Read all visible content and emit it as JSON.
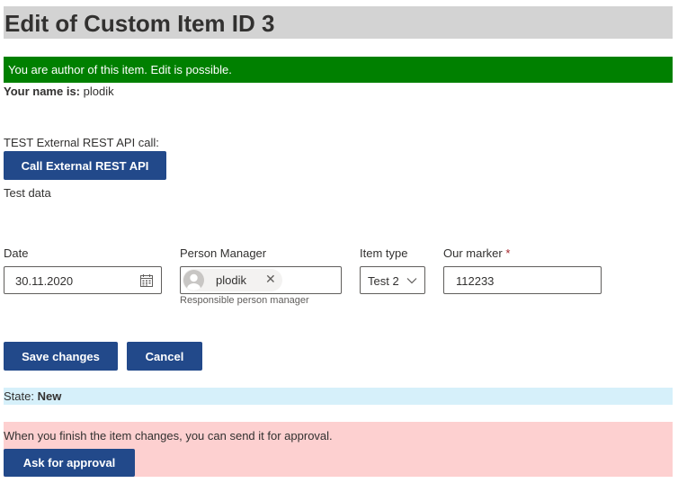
{
  "page": {
    "title": "Edit of Custom Item ID 3",
    "author_message": "You are author of this item. Edit is possible.",
    "your_name_label": "Your name is:",
    "your_name_value": "plodik"
  },
  "rest_api": {
    "label": "TEST External REST API call:",
    "button_label": "Call External REST API",
    "test_data": "Test data"
  },
  "form": {
    "date": {
      "label": "Date",
      "value": "30.11.2020",
      "icon": "calendar-icon"
    },
    "person_manager": {
      "label": "Person Manager",
      "selected": "plodik",
      "helper": "Responsible person manager",
      "remove_icon": "close-icon"
    },
    "item_type": {
      "label": "Item type",
      "value": "Test 2",
      "icon": "chevron-down-icon"
    },
    "our_marker": {
      "label": "Our marker",
      "required_mark": "*",
      "value": "112233"
    }
  },
  "actions": {
    "save_label": "Save changes",
    "cancel_label": "Cancel"
  },
  "state": {
    "label": "State:",
    "value": "New"
  },
  "approval": {
    "message": "When you finish the item changes, you can send it for approval.",
    "button_label": "Ask for approval"
  },
  "colors": {
    "primary_button": "#22498a",
    "author_bar": "#008000",
    "title_bar": "#d3d3d3",
    "state_bar": "#d6f0fa",
    "approval_bar": "#fdd0d0"
  }
}
